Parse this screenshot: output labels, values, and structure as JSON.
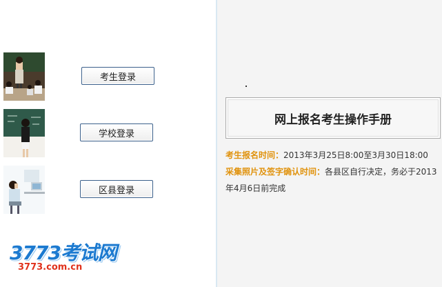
{
  "buttons": {
    "student_login": "考生登录",
    "school_login": "学校登录",
    "county_login": "区县登录"
  },
  "logo": {
    "main": "3773考试网",
    "sub": "3773.com.cn"
  },
  "manual": {
    "title": "网上报名考生操作手册"
  },
  "info": {
    "registration_label": "考生报名时间：",
    "registration_value": "2013年3月25日8:00至3月30日18:00",
    "photo_label": "采集照片及签字确认时间：",
    "photo_value": "各县区自行决定，务必于2013年4月6日前完成"
  },
  "colors": {
    "label_orange": "#e0920c",
    "button_border": "#3a5f8a",
    "logo_blue": "#1c7ad0",
    "logo_red": "#e0321c"
  }
}
